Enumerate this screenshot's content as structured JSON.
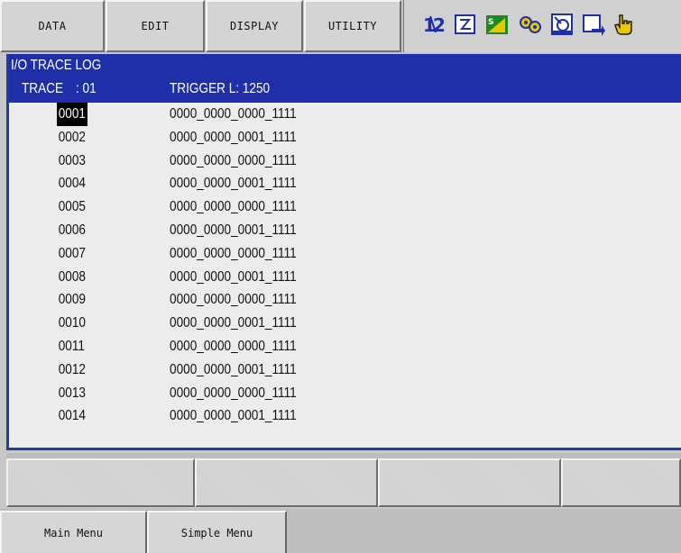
{
  "menu": {
    "data": "DATA",
    "edit": "EDIT",
    "display": "DISPLAY",
    "utility": "UTILITY"
  },
  "status_icons": [
    "number-12-icon",
    "edit-mode-icon",
    "signal-icon",
    "gear-chain-icon",
    "robot-icon",
    "screen-arrow-icon",
    "hand-pointer-icon"
  ],
  "colors": {
    "header_bg": "#1e2fa8",
    "icon_accent": "#e8c800",
    "icon_green": "#1e8a1e"
  },
  "panel": {
    "title": "I/O TRACE LOG",
    "trace_label": "TRACE",
    "trace_sep": ": 01",
    "trigger": "TRIGGER L: 1250"
  },
  "rows": [
    {
      "num": "0001",
      "value": "0000_0000_0000_1111"
    },
    {
      "num": "0002",
      "value": "0000_0000_0001_1111"
    },
    {
      "num": "0003",
      "value": "0000_0000_0000_1111"
    },
    {
      "num": "0004",
      "value": "0000_0000_0001_1111"
    },
    {
      "num": "0005",
      "value": "0000_0000_0000_1111"
    },
    {
      "num": "0006",
      "value": "0000_0000_0001_1111"
    },
    {
      "num": "0007",
      "value": "0000_0000_0000_1111"
    },
    {
      "num": "0008",
      "value": "0000_0000_0001_1111"
    },
    {
      "num": "0009",
      "value": "0000_0000_0000_1111"
    },
    {
      "num": "0010",
      "value": "0000_0000_0001_1111"
    },
    {
      "num": "0011",
      "value": "0000_0000_0000_1111"
    },
    {
      "num": "0012",
      "value": "0000_0000_0001_1111"
    },
    {
      "num": "0013",
      "value": "0000_0000_0000_1111"
    },
    {
      "num": "0014",
      "value": "0000_0000_0001_1111"
    }
  ],
  "selected_row": "0001",
  "bottom": {
    "main_menu": "Main Menu",
    "simple_menu": "Simple Menu"
  }
}
